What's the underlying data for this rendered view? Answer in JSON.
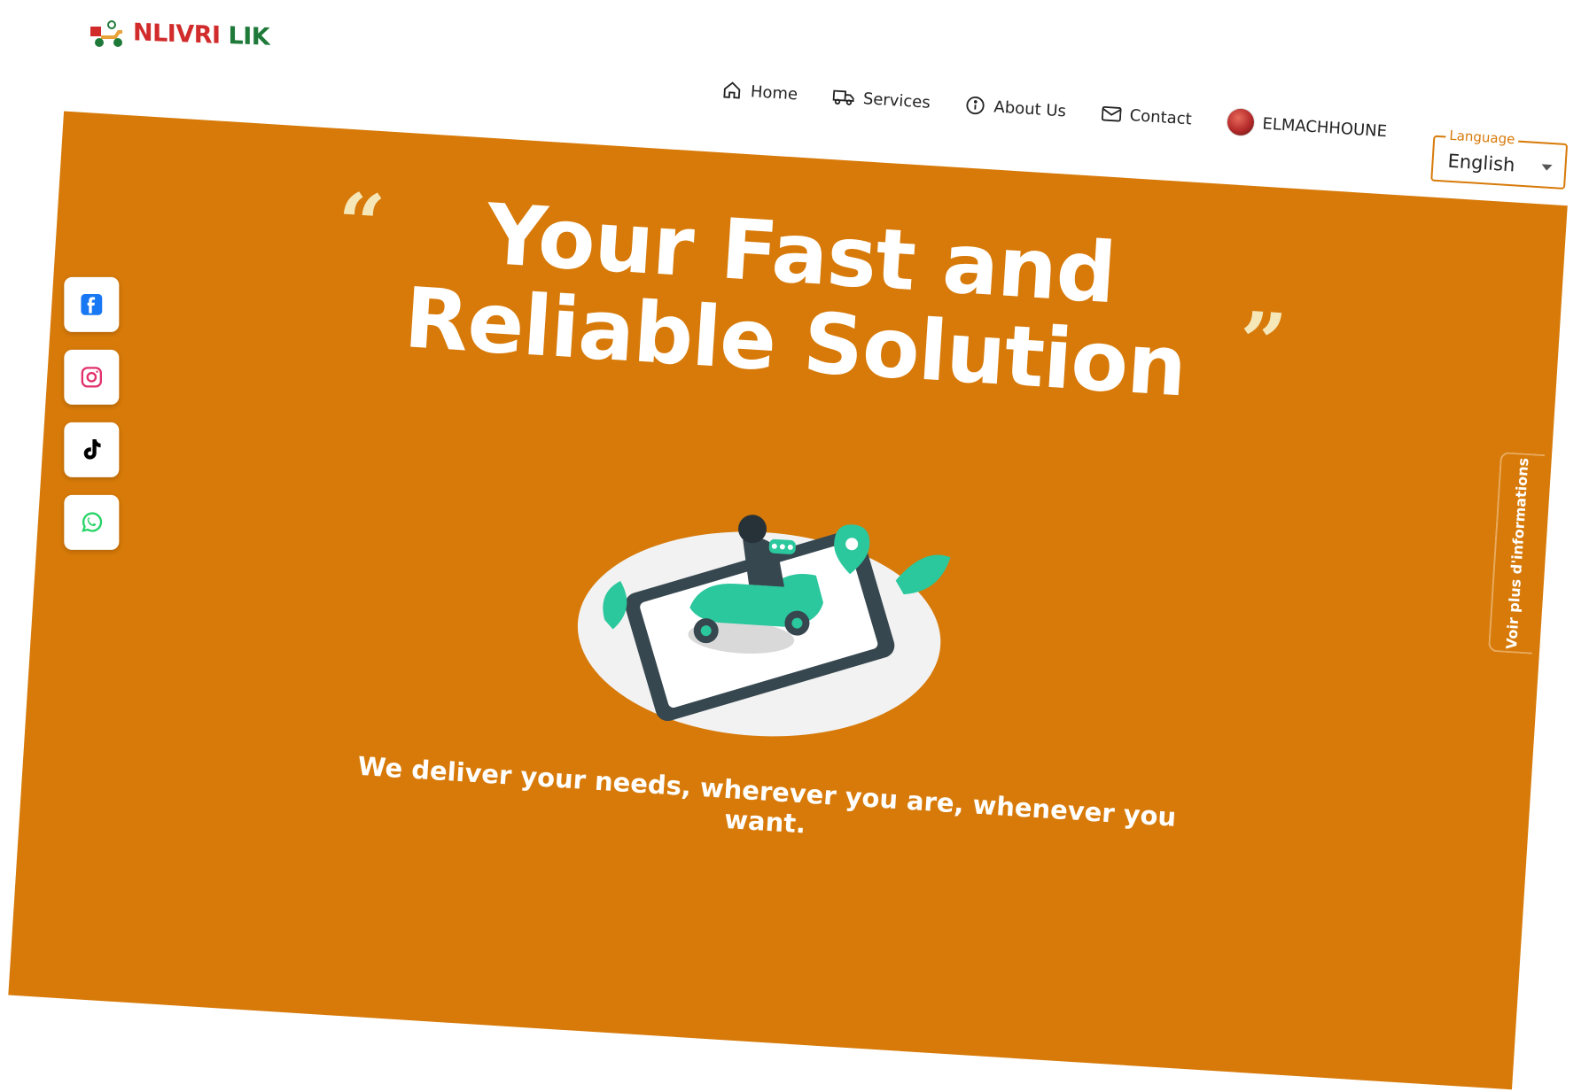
{
  "logo": {
    "text_part1": "NLIVRI",
    "text_part2": "LIK",
    "icon": "delivery-scooter-logo-icon"
  },
  "nav": {
    "items": [
      {
        "label": "Home",
        "icon": "home-icon"
      },
      {
        "label": "Services",
        "icon": "truck-icon"
      },
      {
        "label": "About Us",
        "icon": "info-icon"
      },
      {
        "label": "Contact",
        "icon": "mail-icon"
      }
    ],
    "user": {
      "name": "ELMACHHOUNE"
    }
  },
  "language": {
    "label": "Language",
    "value": "English"
  },
  "hero": {
    "title": "Your Fast and Reliable Solution",
    "tagline": "We deliver your needs, wherever you are, whenever you want."
  },
  "social": [
    {
      "name": "Facebook",
      "icon": "facebook-icon",
      "color": "#1877f2"
    },
    {
      "name": "Instagram",
      "icon": "instagram-icon",
      "color": "#e1306c"
    },
    {
      "name": "TikTok",
      "icon": "tiktok-icon",
      "color": "#000000"
    },
    {
      "name": "WhatsApp",
      "icon": "whatsapp-icon",
      "color": "#25d366"
    }
  ],
  "side_tab": {
    "label": "Voir plus d'informations"
  },
  "colors": {
    "primary": "#d77a09",
    "quote": "#f6e7b9",
    "accent": "#2bc79d"
  }
}
